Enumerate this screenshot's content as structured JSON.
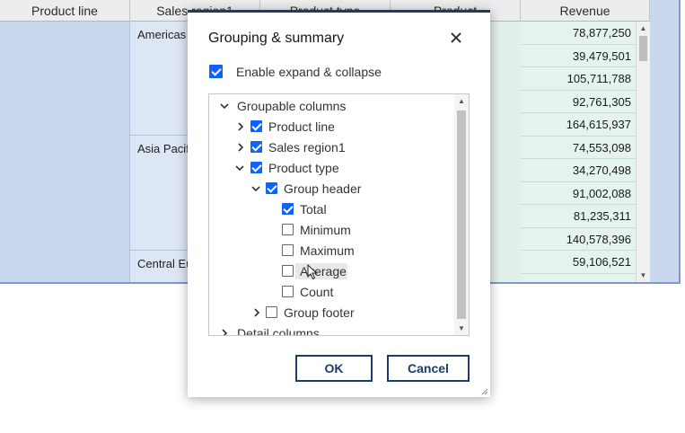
{
  "table": {
    "headers": [
      "Product line",
      "Sales region1",
      "Product type",
      "Product",
      "Revenue"
    ],
    "regions": [
      "Americas",
      "Asia Pacific",
      "Central Europe"
    ],
    "revenue": [
      "78,877,250",
      "39,479,501",
      "105,711,788",
      "92,761,305",
      "164,615,937",
      "74,553,098",
      "34,270,498",
      "91,002,088",
      "81,235,311",
      "140,578,396",
      "59,106,521"
    ]
  },
  "dialog": {
    "title": "Grouping & summary",
    "enable_label": "Enable expand & collapse",
    "enable_checked": true,
    "tree": {
      "root": "Groupable columns",
      "product_line": "Product line",
      "sales_region": "Sales region1",
      "product_type": "Product type",
      "group_header": "Group header",
      "summaries": [
        {
          "label": "Total",
          "checked": true
        },
        {
          "label": "Minimum",
          "checked": false
        },
        {
          "label": "Maximum",
          "checked": false
        },
        {
          "label": "Average",
          "checked": false
        },
        {
          "label": "Count",
          "checked": false
        }
      ],
      "group_footer": "Group footer",
      "detail_columns": "Detail columns"
    },
    "ok_label": "OK",
    "cancel_label": "Cancel"
  },
  "colors": {
    "accent": "#0f62fe",
    "dialog_border": "#1d3b66",
    "table_blue": "#c9d7ef",
    "table_green": "#e1f0ea"
  }
}
